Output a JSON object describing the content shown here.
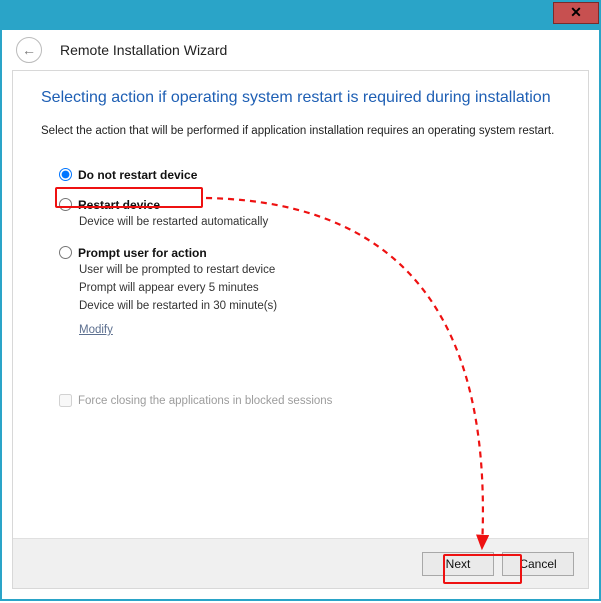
{
  "window": {
    "close": "✕",
    "back": "←",
    "title": "Remote Installation Wizard"
  },
  "page": {
    "heading": "Selecting action if operating system restart is required during installation",
    "instruction": "Select the action that will be performed if application installation requires an operating system restart."
  },
  "options": {
    "no_restart": {
      "label": "Do not restart device"
    },
    "restart": {
      "label": "Restart device",
      "desc": "Device will be restarted automatically"
    },
    "prompt": {
      "label": "Prompt user for action",
      "desc1": "User will be prompted to restart device",
      "desc2": "Prompt will appear every 5 minutes",
      "desc3": "Device will be restarted in 30 minute(s)"
    },
    "modify": "Modify"
  },
  "checkbox": {
    "force_close": "Force closing the applications in blocked sessions"
  },
  "buttons": {
    "next": "Next",
    "cancel": "Cancel"
  }
}
